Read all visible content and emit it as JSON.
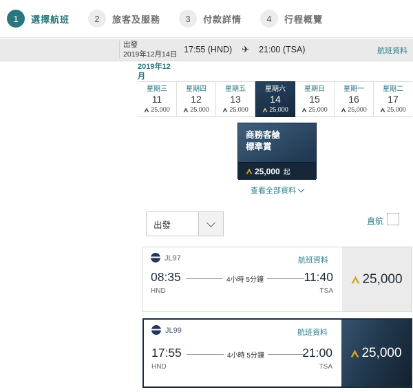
{
  "steps": [
    {
      "number": "1",
      "label": "選擇航班"
    },
    {
      "number": "2",
      "label": "旅客及服務"
    },
    {
      "number": "3",
      "label": "付款詳情"
    },
    {
      "number": "4",
      "label": "行程概覽"
    }
  ],
  "summary_bar": {
    "direction_label": "出發",
    "date": "2019年12月14日",
    "departure_time": "17:55 (HND)",
    "arrival_time": "21:00 (TSA)",
    "plane_icon": "✈",
    "flight_info_link": "航班資料"
  },
  "calendar": {
    "month_line1": "2019年12",
    "month_line2": "月",
    "days": [
      {
        "weekday": "星期三",
        "day": "11",
        "miles": "25,000"
      },
      {
        "weekday": "星期四",
        "day": "12",
        "miles": "25,000"
      },
      {
        "weekday": "星期五",
        "day": "13",
        "miles": "25,000"
      },
      {
        "weekday": "星期六",
        "day": "14",
        "miles": "25,000",
        "selected": true
      },
      {
        "weekday": "星期日",
        "day": "15",
        "miles": "25,000"
      },
      {
        "weekday": "星期一",
        "day": "16",
        "miles": "25,000"
      },
      {
        "weekday": "星期二",
        "day": "17",
        "miles": "25,000"
      }
    ]
  },
  "fare_card": {
    "cabin": "商務客艙",
    "award": "標準賞",
    "miles_from": "25,000",
    "from_suffix": "起",
    "view_all_link": "查看全部資料"
  },
  "filters": {
    "sort_select_value": "出發",
    "direct_label": "直航",
    "direct_checked": false
  },
  "flights": [
    {
      "flight_no": "JL97",
      "info_link": "航班資料",
      "dep_time": "08:35",
      "dep_airport": "HND",
      "duration": "4小時 5分鐘",
      "arr_time": "11:40",
      "arr_airport": "TSA",
      "miles": "25,000",
      "selected": false
    },
    {
      "flight_no": "JL99",
      "info_link": "航班資料",
      "dep_time": "17:55",
      "dep_airport": "HND",
      "duration": "4小時 5分鐘",
      "arr_time": "21:00",
      "arr_airport": "TSA",
      "miles": "25,000",
      "selected": true
    }
  ],
  "colors": {
    "accent_teal": "#2a767e",
    "link_teal": "#2f7f8d",
    "navy_dark": "#1c2b3a",
    "navy_selected_tab": "#1e3a54",
    "gold_miles_icon": "#d2a41d",
    "grey_bar": "#eaeaea",
    "grey_price_cell": "#ebebeb"
  }
}
